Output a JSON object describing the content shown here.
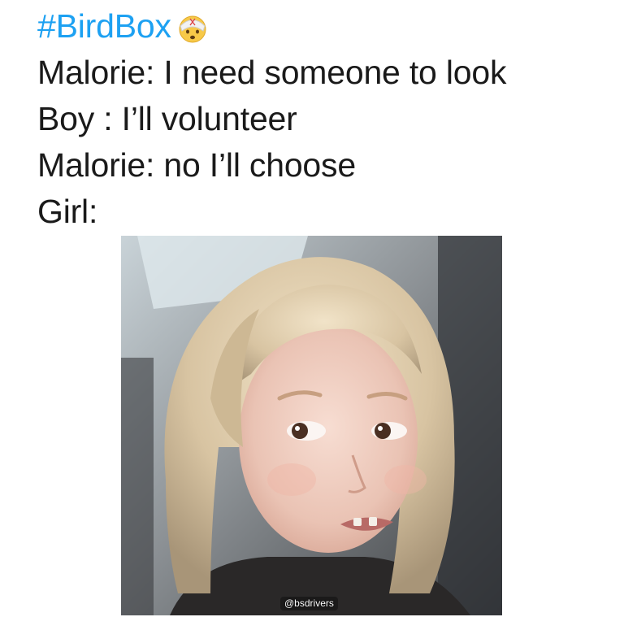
{
  "tweet": {
    "hashtag": "#BirdBox",
    "emoji_icon": "face-with-head-bandage-icon",
    "lines": [
      "Malorie: I need someone to look",
      "Boy : I’ll volunteer",
      "Malorie: no I’ll choose",
      "Girl:"
    ]
  },
  "image": {
    "subject": "side-eyeing-girl-photo",
    "watermark": "@bsdrivers"
  },
  "colors": {
    "hashtag": "#1da1f2",
    "text": "#1a1a1a",
    "background": "#ffffff"
  }
}
